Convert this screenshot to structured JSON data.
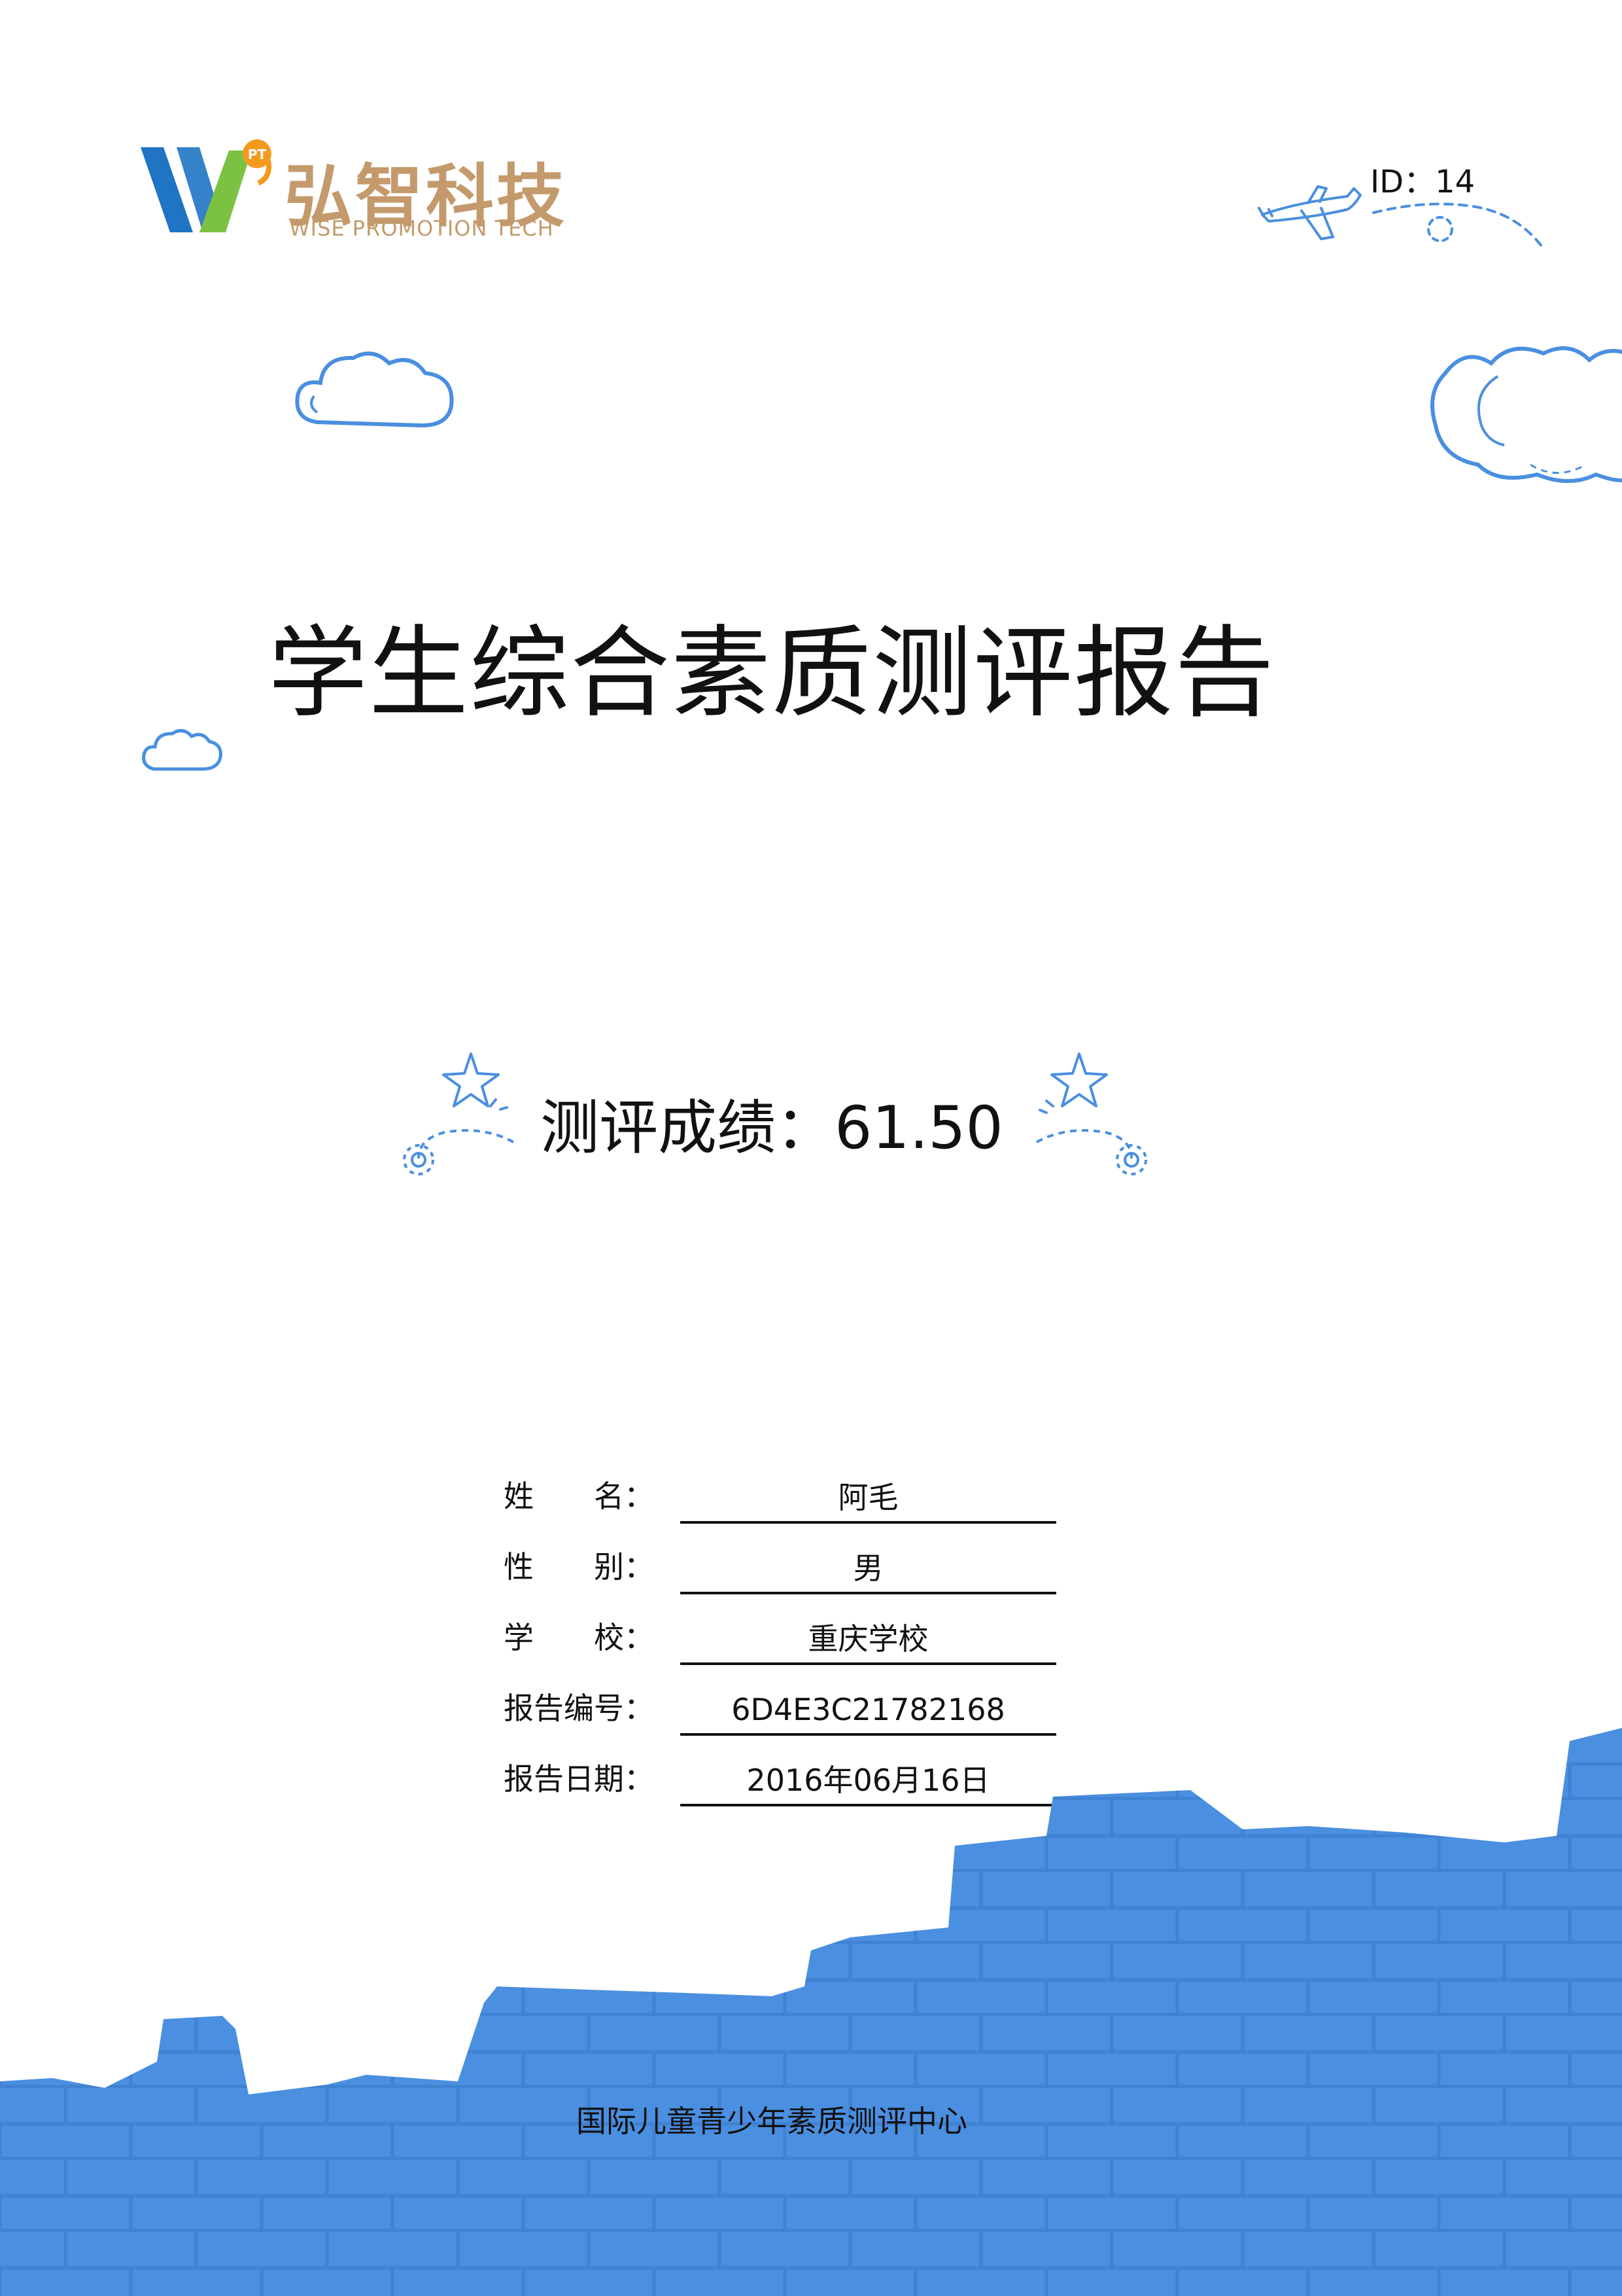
{
  "brand": {
    "name_cn": "弘智科技",
    "name_en": "WISE PROMOTION TECH",
    "mark_letters": "PT",
    "colors": {
      "blue": "#1f74c4",
      "green": "#7cc242",
      "orange": "#f39a1e",
      "text": "#c49a6c"
    }
  },
  "document": {
    "id_label": "ID：14",
    "title": "学生综合素质测评报告",
    "score_line": "测评成绩：61.50"
  },
  "info": [
    {
      "label": "姓　　名：",
      "value": "阿毛"
    },
    {
      "label": "性　　别：",
      "value": "男"
    },
    {
      "label": "学　　校：",
      "value": "重庆学校"
    },
    {
      "label": "报告编号：",
      "value": "6D4E3C21782168"
    },
    {
      "label": "报告日期：",
      "value": "2016年06月16日"
    }
  ],
  "footer": {
    "organization": "国际儿童青少年素质测评中心"
  },
  "theme": {
    "accent_blue": "#4a8fe0",
    "line_blue": "#5b9ee0"
  },
  "icons": [
    "cloud-icon",
    "airplane-icon",
    "star-icon",
    "swirl-icon"
  ]
}
